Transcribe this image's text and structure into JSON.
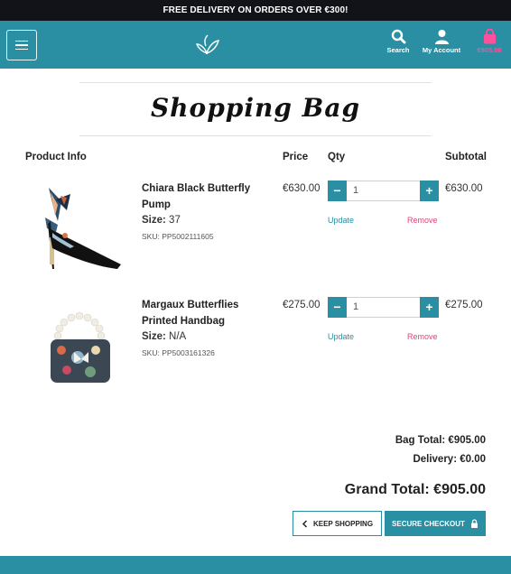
{
  "promo": {
    "text": "FREE DELIVERY ON ORDERS OVER €300!"
  },
  "header": {
    "search_label": "Search",
    "account_label": "My Account",
    "bag_amount": "€905.00",
    "brand_color": "#2a8fa3",
    "bag_color": "#ff4f9d",
    "icons": [
      "menu-icon",
      "butterfly-logo",
      "search-icon",
      "user-icon",
      "bag-icon"
    ]
  },
  "page": {
    "title": "Shopping Bag"
  },
  "columns": {
    "product_info": "Product Info",
    "price": "Price",
    "qty": "Qty",
    "subtotal": "Subtotal"
  },
  "items": [
    {
      "name": "Chiara Black Butterfly Pump",
      "size_label": "Size:",
      "size": "37",
      "sku": "SKU: PP5002111605",
      "price": "€630.00",
      "qty": "1",
      "update": "Update",
      "remove": "Remove",
      "subtotal": "€630.00"
    },
    {
      "name": "Margaux Butterflies Printed Handbag",
      "size_label": "Size:",
      "size": "N/A",
      "sku": "SKU: PP5003161326",
      "price": "€275.00",
      "qty": "1",
      "update": "Update",
      "remove": "Remove",
      "subtotal": "€275.00"
    }
  ],
  "totals": {
    "bag_total": "Bag Total: €905.00",
    "delivery": "Delivery: €0.00",
    "grand_total": "Grand Total: €905.00"
  },
  "actions": {
    "keep_shopping": "KEEP SHOPPING",
    "secure_checkout": "SECURE CHECKOUT"
  }
}
